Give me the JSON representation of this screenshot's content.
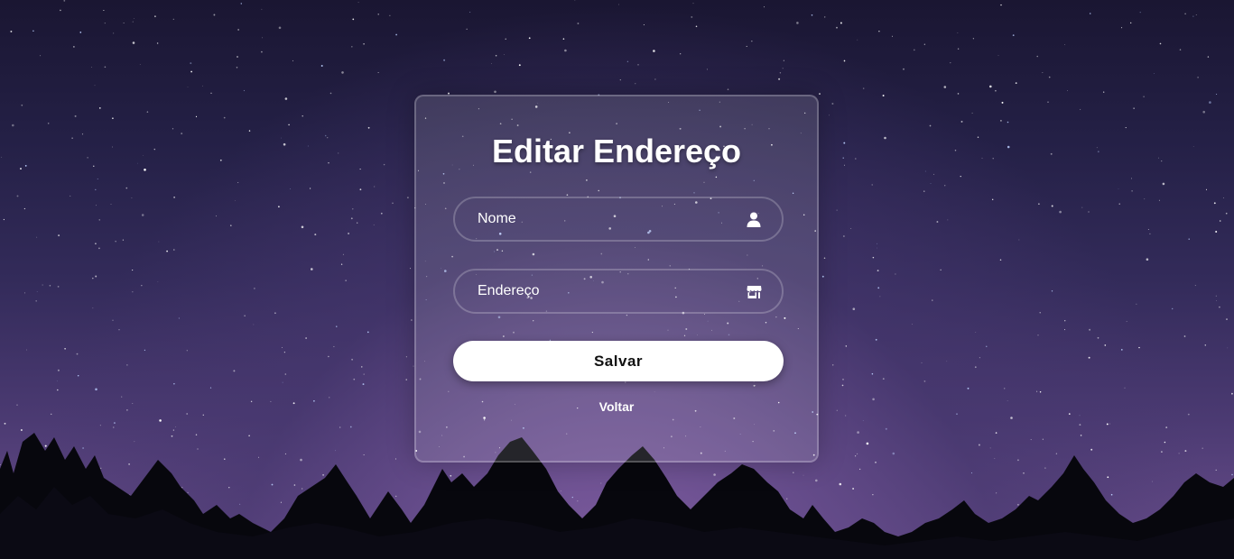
{
  "form": {
    "title": "Editar Endereço",
    "fields": {
      "nome": {
        "placeholder": "Nome",
        "value": "",
        "icon": "user-icon"
      },
      "endereco": {
        "placeholder": "Endereço",
        "value": "",
        "icon": "store-icon"
      }
    },
    "submit_label": "Salvar",
    "back_label": "Voltar"
  },
  "colors": {
    "card_border": "#ffffff38",
    "button_bg": "#ffffff",
    "button_text": "#111111",
    "text": "#ffffff"
  }
}
